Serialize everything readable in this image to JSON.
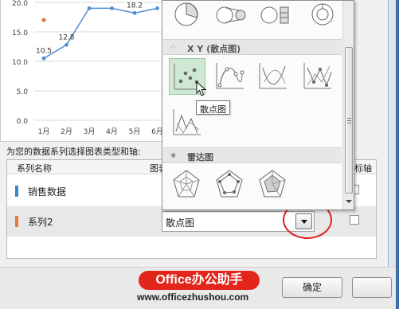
{
  "chart_data": {
    "type": "line",
    "categories": [
      "1月",
      "2月",
      "3月",
      "4月",
      "5月",
      "6月"
    ],
    "y_ticks": [
      "0.0",
      "5.0",
      "10.0",
      "15.0",
      "20.0"
    ],
    "ylim": [
      0,
      20
    ],
    "series": [
      {
        "values": [
          10.5,
          12.8,
          19.0,
          19.0,
          18.2,
          19.0
        ],
        "color": "#4f8fd0"
      },
      {
        "values": [
          17.0
        ],
        "color": "#e37a3a"
      }
    ],
    "data_labels": [
      {
        "category": "1月",
        "text": "10.5"
      },
      {
        "category": "2月",
        "text": "12.8"
      },
      {
        "category": "5月",
        "text": "18.2"
      }
    ],
    "grid": true
  },
  "dialog": {
    "prompt_label": "为您的数据系列选择图表类型和轴:",
    "columns": {
      "series_name": "系列名称",
      "chart_type": "图表",
      "secondary_axis": "标轴"
    },
    "rows": [
      {
        "name": "销售数据",
        "color": "#3a86c8"
      },
      {
        "name": "系列2",
        "color": "#e37a3a",
        "chart_type": "散点图"
      }
    ]
  },
  "gallery": {
    "sections": [
      {
        "title": "X Y (散点图)",
        "icon": "scatter-section-icon"
      },
      {
        "title": "雷达图",
        "icon": "radar-section-icon"
      }
    ],
    "tooltip": "散点图"
  },
  "buttons": {
    "ok": "确定"
  },
  "watermark": {
    "brand": "Office办公助手",
    "url": "www.officezhushou.com"
  },
  "colors": {
    "highlight_ring": "#e02020",
    "selected_thumb": "#cfe8d4"
  }
}
